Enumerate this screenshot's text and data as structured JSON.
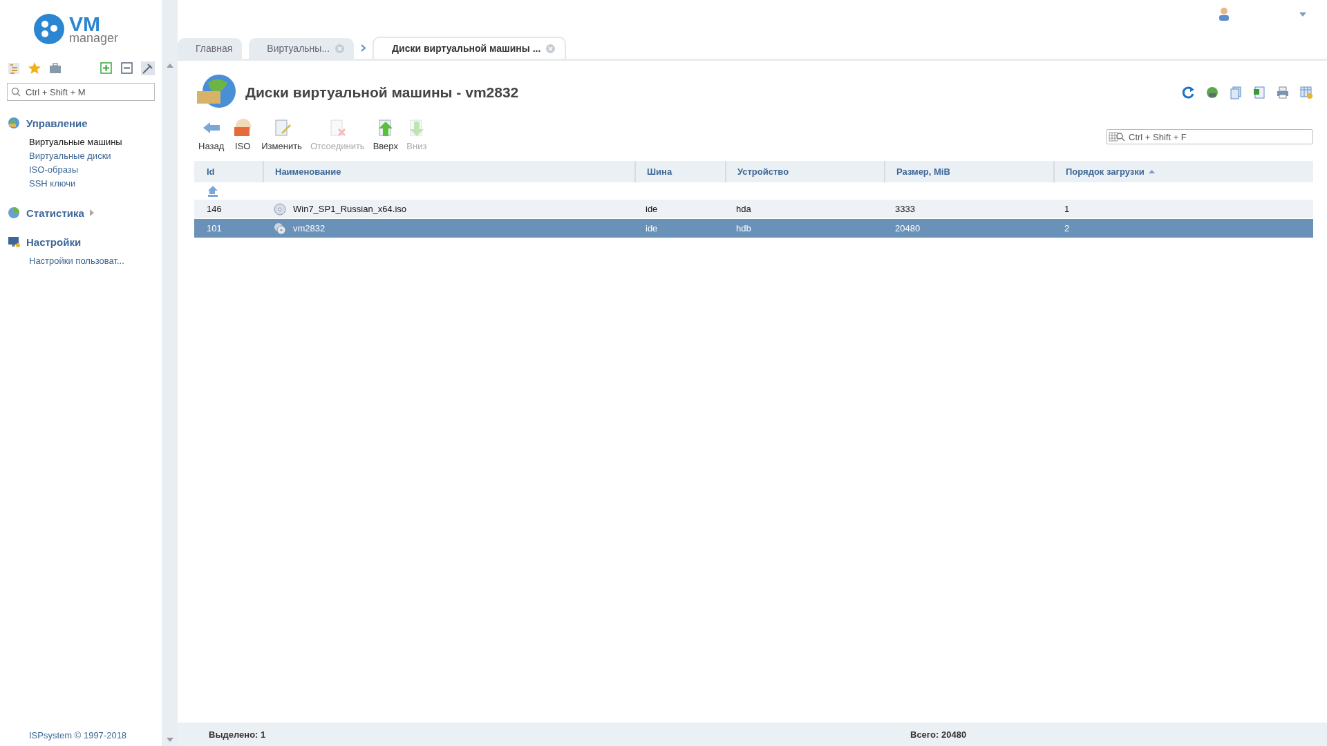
{
  "logo": {
    "title": "VM",
    "subtitle": "manager"
  },
  "sidebar": {
    "search": {
      "placeholder": "Ctrl + Shift + M"
    },
    "groups": [
      {
        "title": "Управление",
        "kind": "manage",
        "has_arrow": false,
        "items": [
          {
            "label": "Виртуальные машины",
            "selected": true
          },
          {
            "label": "Виртуальные диски",
            "selected": false
          },
          {
            "label": "ISO-образы",
            "selected": false
          },
          {
            "label": "SSH ключи",
            "selected": false
          }
        ]
      },
      {
        "title": "Статистика",
        "kind": "stats",
        "has_arrow": true
      },
      {
        "title": "Настройки",
        "kind": "settings",
        "has_arrow": false,
        "items": [
          {
            "label": "Настройки пользоват...",
            "selected": false
          }
        ]
      }
    ],
    "footer": "ISPsystem © 1997-2018"
  },
  "tabs": [
    {
      "label": "Главная",
      "selected": false,
      "closable": false
    },
    {
      "label": "Виртуальны...",
      "selected": false,
      "closable": true
    },
    {
      "label": "Диски виртуальной машины ...",
      "selected": true,
      "closable": true
    }
  ],
  "page": {
    "title": "Диски виртуальной машины - vm2832"
  },
  "toolbar": [
    {
      "label": "Назад",
      "kind": "back",
      "disabled": false
    },
    {
      "label": "ISO",
      "kind": "iso",
      "disabled": false
    },
    {
      "label": "Изменить",
      "kind": "edit",
      "disabled": false
    },
    {
      "label": "Отсоединить",
      "kind": "detach",
      "disabled": true
    },
    {
      "label": "Вверх",
      "kind": "up",
      "disabled": false
    },
    {
      "label": "Вниз",
      "kind": "down",
      "disabled": true
    }
  ],
  "filter": {
    "placeholder": "Ctrl + Shift + F"
  },
  "table": {
    "columns": [
      {
        "label": "Id",
        "sorted": false
      },
      {
        "label": "Наименование",
        "sorted": false
      },
      {
        "label": "Шина",
        "sorted": false
      },
      {
        "label": "Устройство",
        "sorted": false
      },
      {
        "label": "Размер, MiB",
        "sorted": false
      },
      {
        "label": "Порядок загрузки",
        "sorted": true
      }
    ],
    "rows": [
      {
        "kind": "iso",
        "cells": [
          "146",
          "Win7_SP1_Russian_x64.iso",
          "ide",
          "hda",
          "3333",
          "1"
        ],
        "selected": false
      },
      {
        "kind": "disk",
        "cells": [
          "101",
          "vm2832",
          "ide",
          "hdb",
          "20480",
          "2"
        ],
        "selected": true
      }
    ]
  },
  "status_bar": {
    "selected": "Выделено: 1",
    "total": "Всего: 20480"
  }
}
